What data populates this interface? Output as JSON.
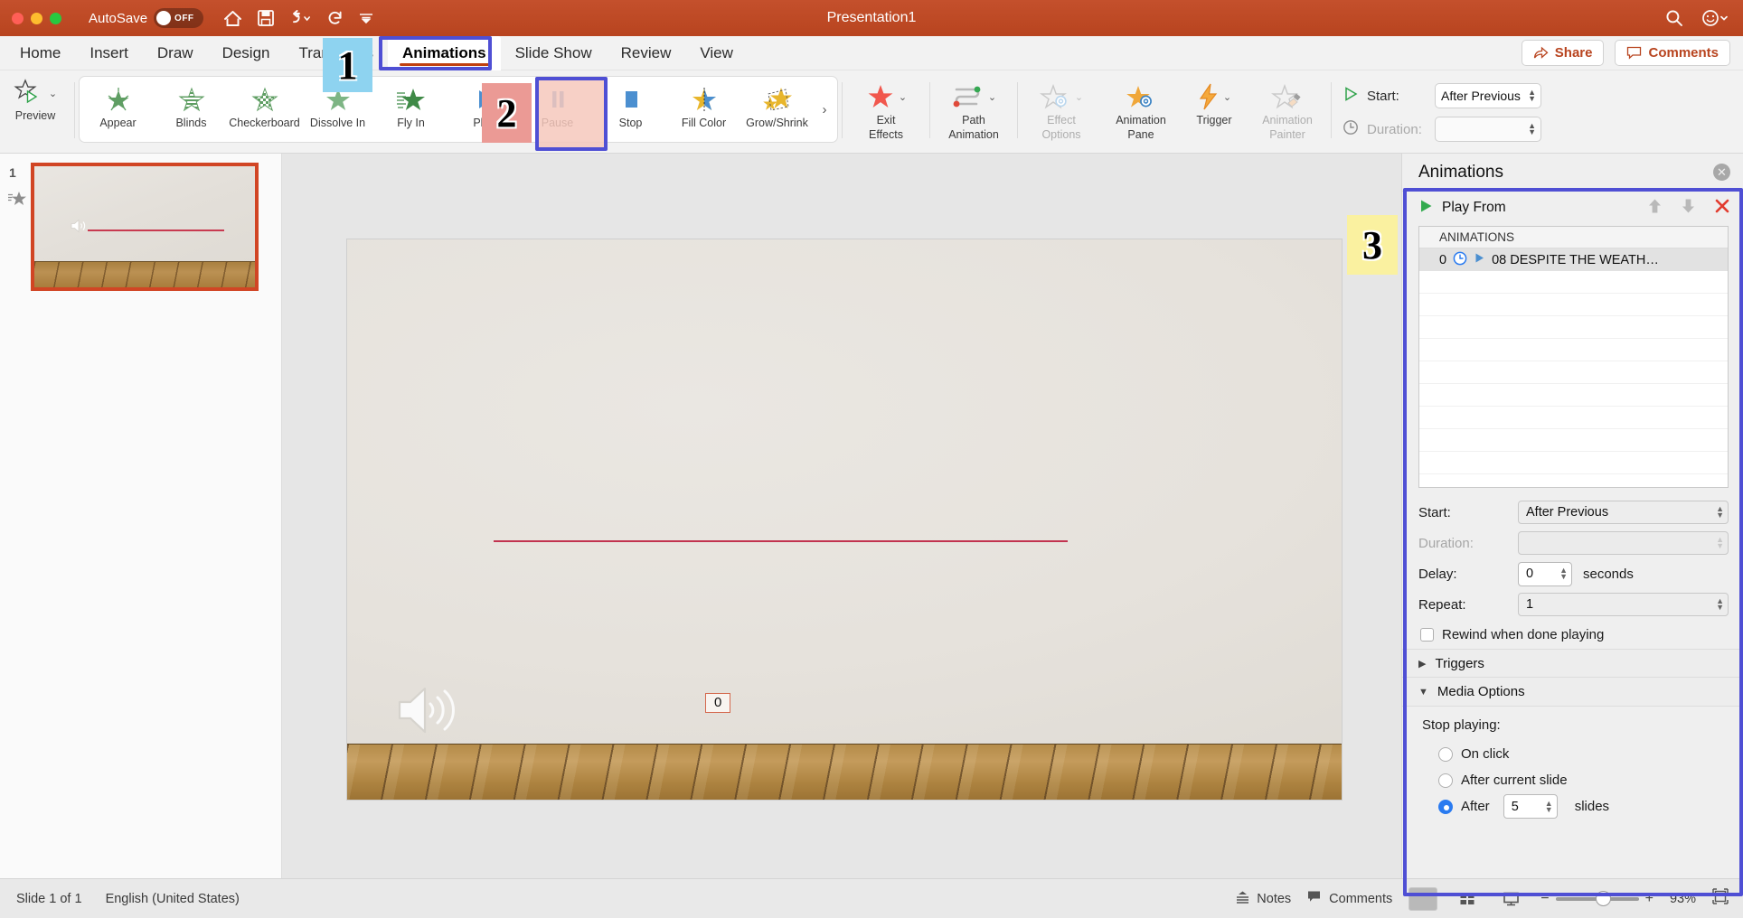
{
  "titlebar": {
    "autosave_label": "AutoSave",
    "autosave_state": "OFF",
    "document_title": "Presentation1",
    "icons": [
      "home-icon",
      "save-icon",
      "undo-icon",
      "redo-icon",
      "customize-toolbar-icon"
    ],
    "right_icons": [
      "search-icon",
      "account-icon"
    ],
    "bg_color": "#bc4a24"
  },
  "tabs": [
    {
      "label": "Home",
      "active": false
    },
    {
      "label": "Insert",
      "active": false
    },
    {
      "label": "Draw",
      "active": false
    },
    {
      "label": "Design",
      "active": false
    },
    {
      "label": "Transitions",
      "active": false
    },
    {
      "label": "Animations",
      "active": true
    },
    {
      "label": "Slide Show",
      "active": false
    },
    {
      "label": "Review",
      "active": false
    },
    {
      "label": "View",
      "active": false
    }
  ],
  "tabbar_actions": {
    "share_label": "Share",
    "comments_label": "Comments",
    "accent_color": "#b8441f"
  },
  "ribbon": {
    "preview_label": "Preview",
    "gallery": [
      {
        "label": "Appear",
        "icon": "appear-star-icon"
      },
      {
        "label": "Blinds",
        "icon": "blinds-star-icon"
      },
      {
        "label": "Checkerboard",
        "icon": "checkerboard-star-icon"
      },
      {
        "label": "Dissolve In",
        "icon": "dissolve-star-icon"
      },
      {
        "label": "Fly In",
        "icon": "flyin-star-icon"
      },
      {
        "label": "Play",
        "icon": "play-triangle-icon"
      },
      {
        "label": "Pause",
        "icon": "pause-bars-icon"
      },
      {
        "label": "Stop",
        "icon": "stop-square-icon"
      },
      {
        "label": "Fill Color",
        "icon": "fill-color-star-icon"
      },
      {
        "label": "Grow/Shrink",
        "icon": "grow-shrink-star-icon"
      }
    ],
    "gallery_more": "›",
    "groups": [
      {
        "label_line1": "Exit",
        "label_line2": "Effects",
        "icon": "exit-effects-star-icon",
        "dropdown": true,
        "disabled": false
      },
      {
        "label_line1": "Path",
        "label_line2": "Animation",
        "icon": "path-animation-icon",
        "dropdown": true,
        "disabled": false
      },
      {
        "label_line1": "Effect",
        "label_line2": "Options",
        "icon": "effect-options-icon",
        "dropdown": true,
        "disabled": true
      },
      {
        "label_line1": "Animation",
        "label_line2": "Pane",
        "icon": "animation-pane-icon",
        "dropdown": false,
        "disabled": false
      },
      {
        "label_line1": "Trigger",
        "label_line2": "",
        "icon": "trigger-bolt-icon",
        "dropdown": true,
        "disabled": false
      },
      {
        "label_line1": "Animation",
        "label_line2": "Painter",
        "icon": "animation-painter-icon",
        "dropdown": false,
        "disabled": true
      }
    ],
    "settings": {
      "start_label": "Start:",
      "start_value": "After Previous",
      "duration_label": "Duration:",
      "duration_value": ""
    }
  },
  "slide_panel": {
    "slide_number": "1",
    "has_animation_star": true
  },
  "canvas": {
    "audio_badge": "0",
    "audio_icon": "speaker-icon"
  },
  "animation_pane": {
    "title": "Animations",
    "close_icon": "close-icon",
    "play_from_label": "Play From",
    "tool_icons": [
      "move-up-icon",
      "move-down-icon",
      "remove-icon"
    ],
    "list_header": "ANIMATIONS",
    "list_rows": [
      {
        "order": "0",
        "timing_icon": "clock-icon",
        "type_icon": "play-icon",
        "name": "08 DESPITE THE WEATH…"
      }
    ],
    "form": {
      "start_label": "Start:",
      "start_value": "After Previous",
      "duration_label": "Duration:",
      "duration_value": "",
      "delay_label": "Delay:",
      "delay_value": "0",
      "delay_unit": "seconds",
      "repeat_label": "Repeat:",
      "repeat_value": "1",
      "rewind_label": "Rewind when done playing",
      "rewind_checked": false
    },
    "sections": [
      {
        "label": "Triggers",
        "expanded": false
      },
      {
        "label": "Media Options",
        "expanded": true
      }
    ],
    "media_options": {
      "stop_playing_label": "Stop playing:",
      "options": [
        {
          "label": "On click",
          "selected": false
        },
        {
          "label": "After current slide",
          "selected": false
        },
        {
          "label": "After",
          "selected": true,
          "count": "5",
          "suffix": "slides"
        }
      ]
    }
  },
  "status_bar": {
    "slide_info": "Slide 1 of 1",
    "language": "English (United States)",
    "notes_label": "Notes",
    "comments_label": "Comments",
    "views": [
      "normal-view-icon",
      "slide-sorter-icon",
      "reading-view-icon"
    ],
    "active_view": "normal-view-icon",
    "zoom_minus": "−",
    "zoom_plus": "+",
    "zoom_level": "93%",
    "fit_icon": "fit-slide-icon"
  },
  "annotations": [
    {
      "number": "1",
      "color": "#8ed3f0",
      "target": "animations-tab"
    },
    {
      "number": "2",
      "color": "#eb9a95",
      "target": "play-button"
    },
    {
      "number": "3",
      "color": "#faf1a0",
      "target": "animation-pane"
    }
  ]
}
